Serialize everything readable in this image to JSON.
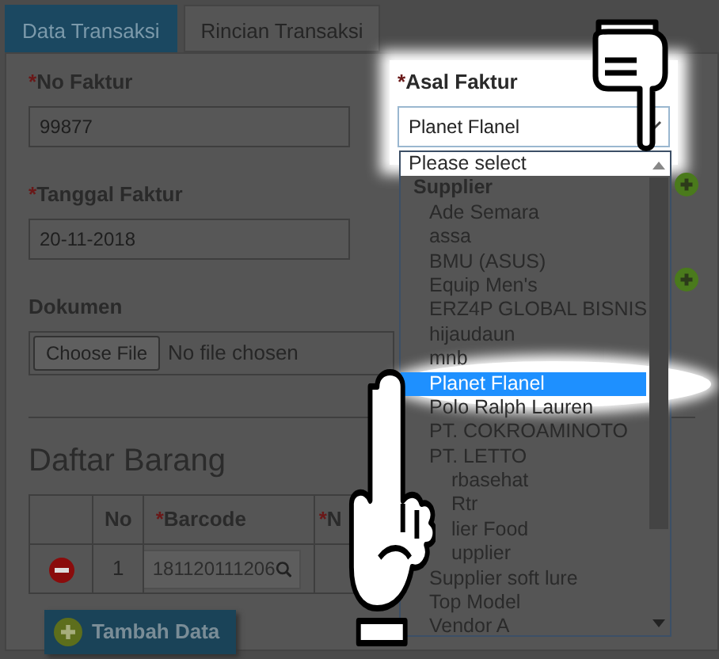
{
  "tabs": [
    {
      "label": "Data Transaksi",
      "selected": true
    },
    {
      "label": "Rincian Transaksi",
      "selected": false
    }
  ],
  "left_fields": [
    {
      "kind": "text",
      "mark": "*",
      "label": "No Faktur",
      "value": "99877"
    },
    {
      "kind": "text",
      "mark": "*",
      "label": "Tanggal Faktur",
      "value": "20-11-2018"
    },
    {
      "kind": "file",
      "label": "Dokumen",
      "button": "Choose File",
      "status": "No file chosen"
    }
  ],
  "asal_faktur": {
    "mark": "*",
    "label": "Asal Faktur",
    "value": "Planet Flanel",
    "spotlight": true,
    "options": [
      {
        "kind": "placeholder",
        "label": "Please select",
        "selected": false
      },
      {
        "kind": "group",
        "label": "Supplier",
        "selected": false
      },
      {
        "kind": "option",
        "label": "Ade Semara",
        "selected": false
      },
      {
        "kind": "option",
        "label": "assa",
        "selected": false
      },
      {
        "kind": "option",
        "label": "BMU (ASUS)",
        "selected": false
      },
      {
        "kind": "option",
        "label": "Equip Men's",
        "selected": false
      },
      {
        "kind": "option",
        "label": "ERZ4P GLOBAL BISNIS",
        "selected": false
      },
      {
        "kind": "option",
        "label": "hijaudaun",
        "selected": false
      },
      {
        "kind": "option",
        "label": "mnb",
        "selected": false
      },
      {
        "kind": "option",
        "label": "Planet Flanel",
        "selected": true,
        "spotlight": true
      },
      {
        "kind": "option",
        "label": "Polo Ralph Lauren",
        "selected": false
      },
      {
        "kind": "option",
        "label": "PT. COKROAMINOTO",
        "selected": false
      },
      {
        "kind": "option",
        "label": "PT. LETTO",
        "selected": false
      },
      {
        "kind": "option",
        "label": "rbasehat",
        "selected": false,
        "covered": true
      },
      {
        "kind": "option",
        "label": "Rtr",
        "selected": false,
        "covered": true
      },
      {
        "kind": "option",
        "label": "lier Food",
        "selected": false,
        "covered": true
      },
      {
        "kind": "option",
        "label": "upplier",
        "selected": false,
        "covered": true
      },
      {
        "kind": "option",
        "label": "Supplier soft lure",
        "selected": false
      },
      {
        "kind": "option",
        "label": "Top Model",
        "selected": false
      },
      {
        "kind": "option",
        "label": "Vendor A",
        "selected": false
      }
    ]
  },
  "section_title": "Daftar Barang",
  "table": {
    "columns": [
      {
        "kind": "blank"
      },
      {
        "kind": "text",
        "label": "No"
      },
      {
        "kind": "text",
        "mark": "*",
        "label": "Barcode"
      },
      {
        "kind": "text",
        "mark": "*",
        "label": "N"
      }
    ],
    "rows": [
      {
        "no": "1",
        "barcode": "181120111206"
      }
    ]
  },
  "add_button": "Tambah Data"
}
